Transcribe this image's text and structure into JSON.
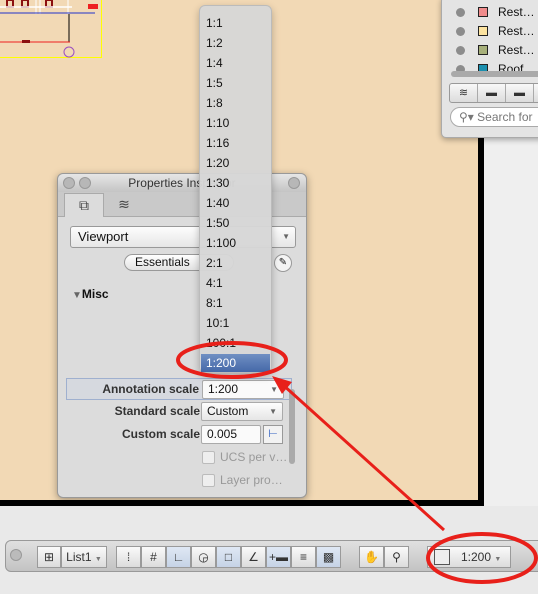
{
  "layers_panel": {
    "layers": [
      {
        "name": "Rest…",
        "color": "#f08c8c"
      },
      {
        "name": "Rest…",
        "color": "#fce3a0"
      },
      {
        "name": "Rest…",
        "color": "#a7b07a"
      },
      {
        "name": "Roof",
        "color": "#1b8fae"
      }
    ],
    "search_placeholder": "Search for"
  },
  "properties_inspector": {
    "title": "Properties Inspector",
    "object_type": "Viewport",
    "filter_label": "Essentials",
    "section": "Misc",
    "annotation_scale_label": "Annotation scale",
    "annotation_scale_value": "1:200",
    "standard_scale_label": "Standard scale",
    "standard_scale_value": "Custom",
    "custom_scale_label": "Custom scale",
    "custom_scale_value": "0.005",
    "ucs_label": "UCS per v…",
    "layer_label": "Layer pro…"
  },
  "scale_dropdown": {
    "options": [
      "1:1",
      "1:2",
      "1:4",
      "1:5",
      "1:8",
      "1:10",
      "1:16",
      "1:20",
      "1:30",
      "1:40",
      "1:50",
      "1:100",
      "2:1",
      "4:1",
      "8:1",
      "10:1",
      "100:1",
      "1:200"
    ],
    "selected": "1:200"
  },
  "status_bar": {
    "layout_list": "List1",
    "viewport_scale": "1:200"
  },
  "colors": {
    "highlight": "#e8201a",
    "canvas": "#f2d9b5",
    "selection": "#4f72b0"
  }
}
